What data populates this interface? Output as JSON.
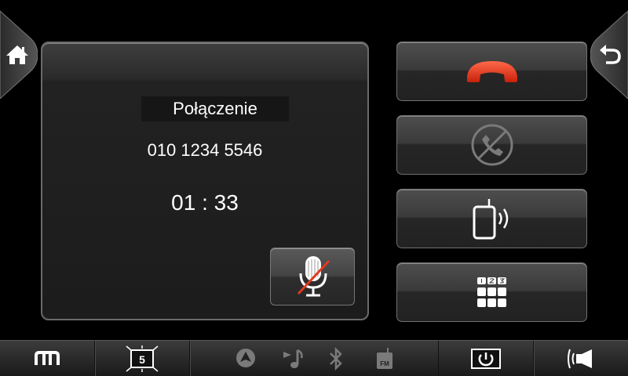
{
  "call": {
    "status_label": "Połączenie",
    "phone_number": "010 1234 5546",
    "duration": "01 : 33"
  },
  "bottom_bar": {
    "screen_count": "5",
    "radio_label": "FM"
  },
  "icons": {
    "home": "home-icon",
    "back": "back-icon",
    "mute": "microphone-muted-icon",
    "hangup": "hang-up-icon",
    "reject": "reject-call-icon",
    "transfer": "transfer-to-phone-icon",
    "keypad": "keypad-icon",
    "menu": "menu-icon",
    "screens": "screens-icon",
    "navigation": "navigation-icon",
    "music": "music-icon",
    "bluetooth": "bluetooth-icon",
    "radio": "radio-icon",
    "power": "power-icon",
    "volume": "volume-icon"
  },
  "colors": {
    "hangup_red": "#e23a1e",
    "text": "#ffffff",
    "icon_white": "#ffffff",
    "icon_dim": "#7a7a7a"
  }
}
